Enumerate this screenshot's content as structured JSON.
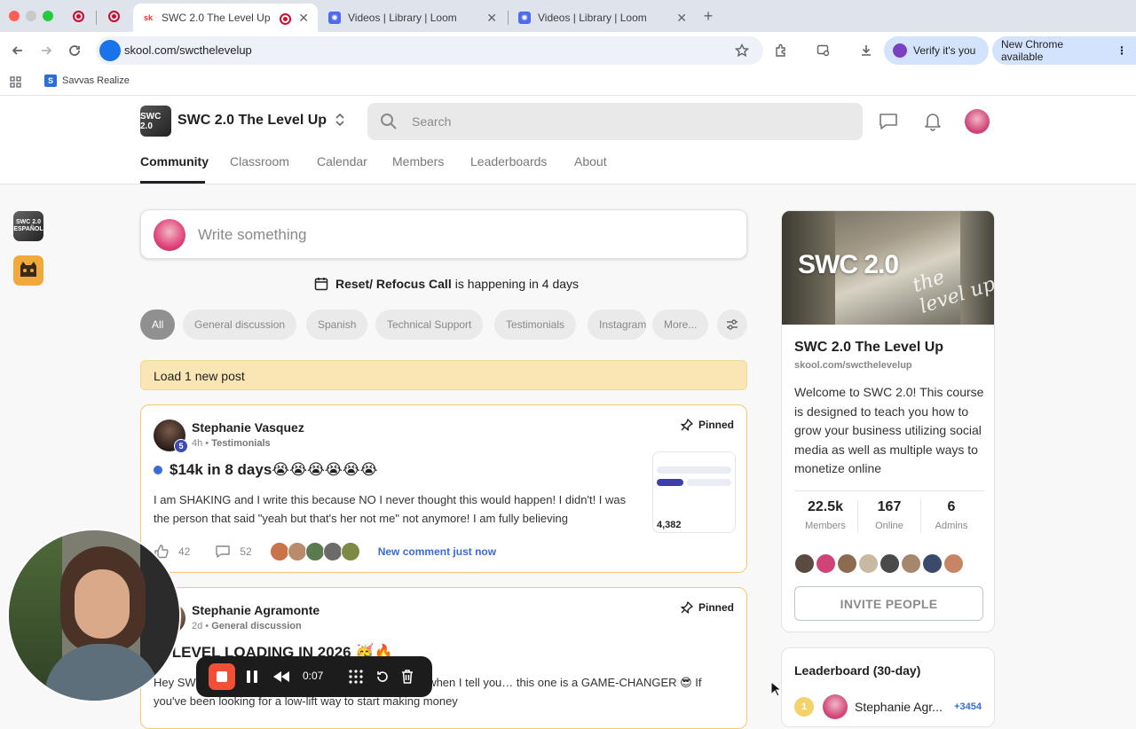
{
  "browser": {
    "tabs": [
      {
        "title": "SWC 2.0 The Level Up",
        "active": true
      },
      {
        "title": "Videos | Library | Loom",
        "active": false
      },
      {
        "title": "Videos | Library | Loom",
        "active": false
      }
    ],
    "url": "skool.com/swcthelevelup",
    "verify_label": "Verify it's you",
    "update_label": "New Chrome available",
    "bookmark": "Savvas Realize"
  },
  "header": {
    "group_logo_text": "SWC 2.0",
    "group_name": "SWC 2.0 The Level Up",
    "search_placeholder": "Search",
    "nav": [
      "Community",
      "Classroom",
      "Calendar",
      "Members",
      "Leaderboards",
      "About"
    ],
    "active_nav": "Community"
  },
  "rail": {
    "item1_text": "SWC 2.0 ESPAÑOL"
  },
  "composer": {
    "placeholder": "Write something"
  },
  "event": {
    "name": "Reset/ Refocus Call",
    "suffix": "is happening in 4 days"
  },
  "filters": [
    "All",
    "General discussion",
    "Spanish",
    "Technical Support",
    "Testimonials",
    "Instagram",
    "More..."
  ],
  "load_new": "Load 1 new post",
  "posts": [
    {
      "author": "Stephanie Vasquez",
      "level": "5",
      "time": "4h",
      "category": "Testimonials",
      "pinned": "Pinned",
      "title": "$14k in 8 days😭😭😭😭😭😭",
      "body": "I am SHAKING and I write this because NO I never thought this would happen! I didn't! I was the person that said \"yeah but that's her not me\" not anymore! I am fully believing",
      "likes": "42",
      "comments": "52",
      "new_comment": "New comment just now",
      "thumb_amount": "4,382"
    },
    {
      "author": "Stephanie Agramonte",
      "time": "2d",
      "category": "General discussion",
      "pinned": "Pinned",
      "title": "W LEVEL LOADING IN 2026 🥳🔥",
      "body": "Hey SW… …dule is DROPPING THIS MONDAY and when I tell you… this one is a GAME-CHANGER 😎 If you've been looking for a low-lift way to start making money"
    }
  ],
  "about": {
    "hero_text": "SWC 2.0",
    "hero_script": "the level up",
    "name": "SWC 2.0 The Level Up",
    "url": "skool.com/swcthelevelup",
    "description": "Welcome to SWC 2.0! This course is designed to teach you how to grow your business utilizing social media as well as multiple ways to monetize online",
    "stats": [
      {
        "value": "22.5k",
        "label": "Members"
      },
      {
        "value": "167",
        "label": "Online"
      },
      {
        "value": "6",
        "label": "Admins"
      }
    ],
    "invite_label": "INVITE PEOPLE"
  },
  "leaderboard": {
    "title": "Leaderboard (30-day)",
    "top": {
      "rank": "1",
      "name": "Stephanie Agr...",
      "points": "+3454"
    }
  },
  "loom": {
    "time": "0:07"
  },
  "colors": {
    "accent_gold": "#f6c96a",
    "load_banner": "#fae6b4",
    "link_blue": "#3b6bd6",
    "loom_red": "#f25036"
  }
}
